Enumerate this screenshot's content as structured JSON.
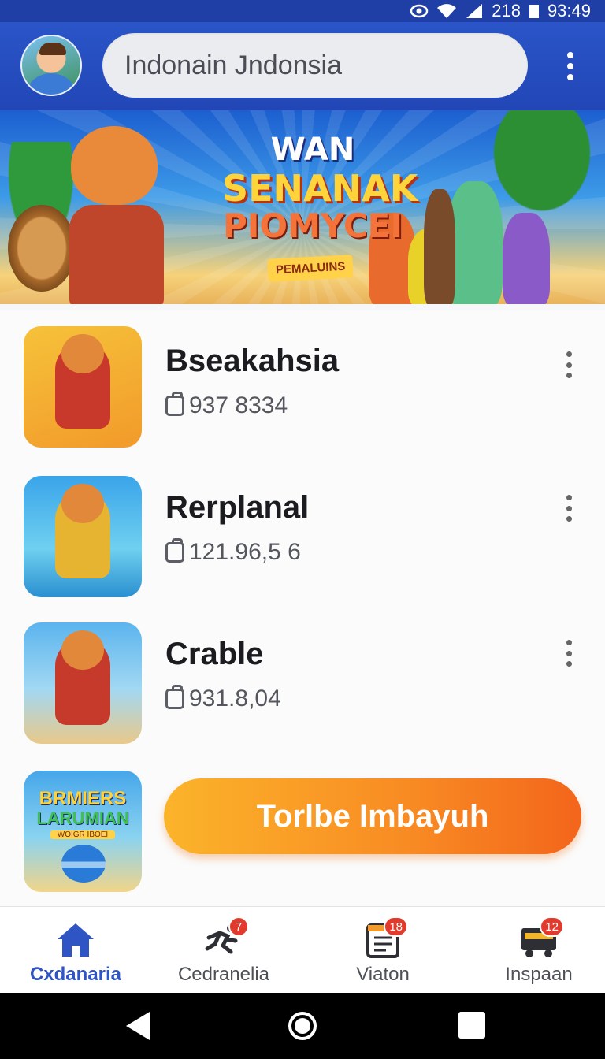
{
  "status_bar": {
    "signal_text": "218",
    "time": "93:49"
  },
  "header": {
    "search_text": "Indonain Jndonsia",
    "menu_icon": "more-vert-icon",
    "avatar_icon": "profile-avatar"
  },
  "banner": {
    "title_line1": "WAN",
    "title_line2": "SENANAK",
    "title_line3": "PIOMYCEI",
    "tag": "PEMALUINS"
  },
  "list": {
    "items": [
      {
        "title": "Bseakahsia",
        "meta": "937 8334",
        "meta_icon": "bag-icon"
      },
      {
        "title": "Rerplanal",
        "meta": "121.96,5 6",
        "meta_icon": "bag-icon"
      },
      {
        "title": "Crable",
        "meta": "931.8,04",
        "meta_icon": "bag-icon"
      }
    ],
    "promo": {
      "thumb_line1": "BRMIERS",
      "thumb_line2": "LARUMIAN",
      "thumb_line3": "WOIGR IBOEI"
    },
    "cta_label": "Torlbe Imbayuh"
  },
  "bottom_nav": [
    {
      "label": "Cxdanaria",
      "icon": "home-icon",
      "badge": ""
    },
    {
      "label": "Cedranelia",
      "icon": "run-icon",
      "badge": "7"
    },
    {
      "label": "Viaton",
      "icon": "list-icon",
      "badge": "18"
    },
    {
      "label": "Inspaan",
      "icon": "inbox-icon",
      "badge": "12"
    }
  ],
  "colors": {
    "header": "#2246b6",
    "accent": "#2f55c4",
    "cta_start": "#fbb42a",
    "cta_end": "#f3651b",
    "badge": "#e23b2e"
  }
}
